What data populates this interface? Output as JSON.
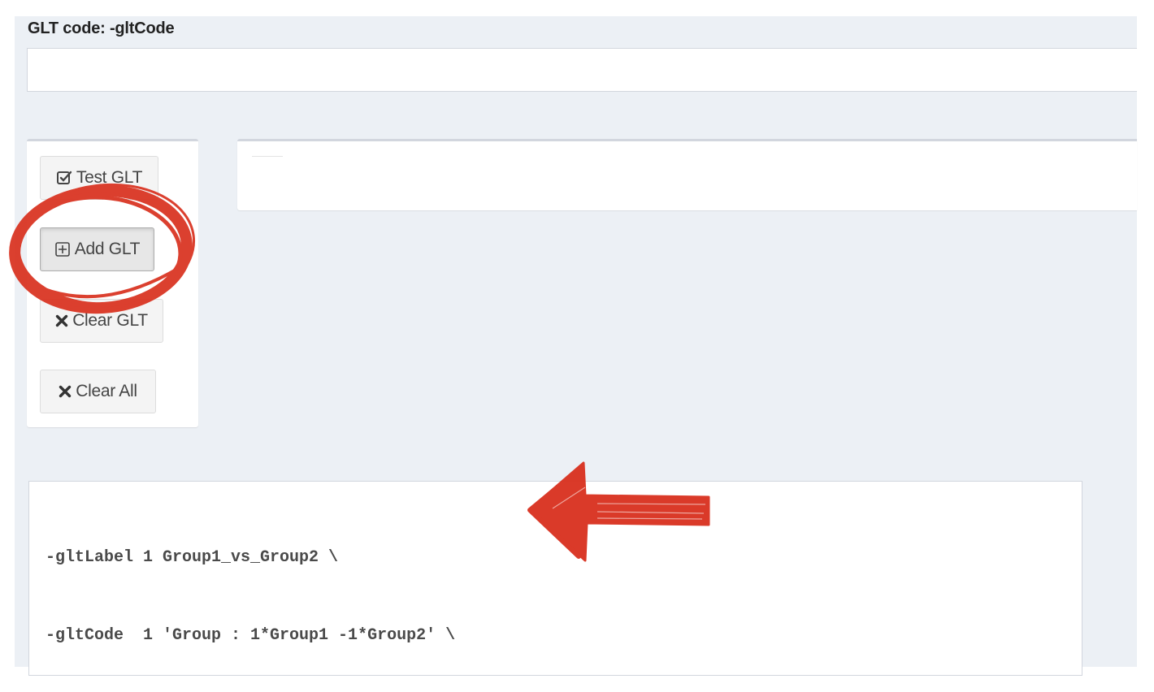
{
  "glt_code_field": {
    "label": "GLT code: -gltCode",
    "value": "",
    "placeholder": ""
  },
  "actions": {
    "test_glt": "Test GLT",
    "add_glt": "Add GLT",
    "clear_glt": "Clear GLT",
    "clear_all": "Clear All"
  },
  "output": {
    "lines": [
      "-gltLabel 1 Group1_vs_Group2 \\",
      "-gltCode  1 'Group : 1*Group1 -1*Group2' \\"
    ]
  },
  "icons": {
    "test_glt": "check-square-icon",
    "add_glt": "plus-square-icon",
    "clear_glt": "times-icon",
    "clear_all": "times-icon"
  },
  "annotation_color": "#d9301e"
}
